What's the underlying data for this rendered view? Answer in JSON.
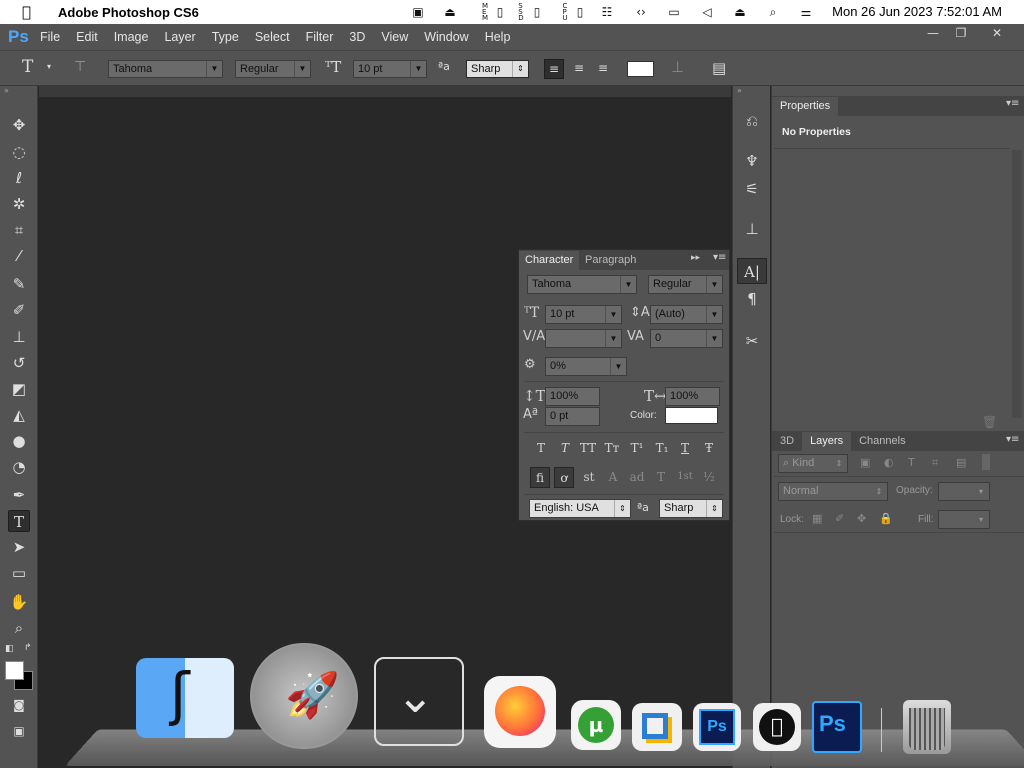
{
  "macbar": {
    "app_name": "Adobe Photoshop CS6",
    "clock": "Mon 26 Jun 2023 7:52:01 AM",
    "status_icons": [
      "display-icon",
      "eject-icon",
      "memory-icon",
      "battery-icon",
      "ssd-icon",
      "phone-icon",
      "cpu-icon",
      "phone-icon",
      "stats-icon",
      "arrows-icon",
      "monitor-icon",
      "mute-icon",
      "eject-icon",
      "search-icon",
      "control-center-icon"
    ]
  },
  "ps": {
    "logo": "Ps",
    "menu": [
      "File",
      "Edit",
      "Image",
      "Layer",
      "Type",
      "Select",
      "Filter",
      "3D",
      "View",
      "Window",
      "Help"
    ],
    "window_buttons": [
      "—",
      "❐",
      "✕"
    ]
  },
  "options": {
    "font_family": "Tahoma",
    "font_style": "Regular",
    "font_size": "10 pt",
    "antialias_glyph": "ªa",
    "antialias": "Sharp",
    "swatch_color": "#ffffff"
  },
  "character_panel": {
    "tabs": [
      "Character",
      "Paragraph"
    ],
    "font_family": "Tahoma",
    "font_style": "Regular",
    "size": "10 pt",
    "leading": "(Auto)",
    "kerning": "",
    "tracking": "0",
    "tsume": "0%",
    "vscale": "100%",
    "hscale": "100%",
    "baseline": "0 pt",
    "color_label": "Color:",
    "color": "#ffffff",
    "type_styles": [
      "T",
      "T",
      "TT",
      "Tт",
      "T¹",
      "T₁",
      "T",
      "Ŧ"
    ],
    "opentype": [
      "ﬁ",
      "ơ",
      "st",
      "A",
      "ad",
      "T",
      "1st",
      "½"
    ],
    "language": "English: USA",
    "antialias_glyph": "ªa",
    "antialias": "Sharp"
  },
  "properties_panel": {
    "tab": "Properties",
    "message": "No Properties"
  },
  "layers_panel": {
    "tabs": [
      "3D",
      "Layers",
      "Channels"
    ],
    "filter_kind": "Kind",
    "blend_mode": "Normal",
    "opacity_label": "Opacity:",
    "lock_label": "Lock:",
    "fill_label": "Fill:"
  },
  "dock": {
    "apps": [
      "Finder",
      "Launchpad",
      "Downloads",
      "Firefox",
      "uTorrent",
      "Parallels",
      "Photoshop",
      "Apple",
      "Photoshop",
      "Trash"
    ]
  }
}
